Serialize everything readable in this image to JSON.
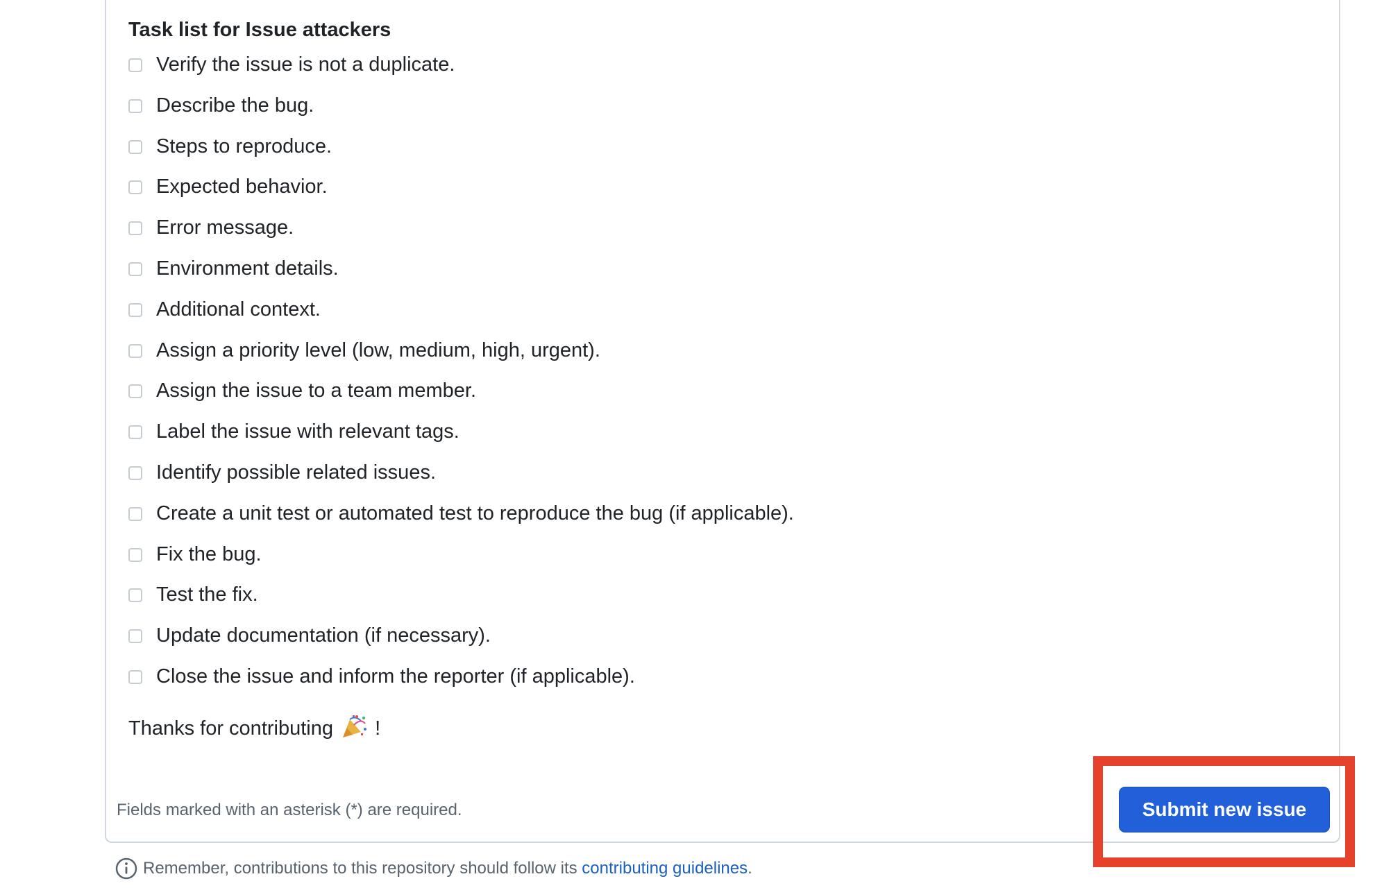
{
  "task_section": {
    "heading": "Task list for Issue attackers",
    "items": [
      {
        "label": "Verify the issue is not a duplicate.",
        "checked": false
      },
      {
        "label": "Describe the bug.",
        "checked": false
      },
      {
        "label": "Steps to reproduce.",
        "checked": false
      },
      {
        "label": "Expected behavior.",
        "checked": false
      },
      {
        "label": "Error message.",
        "checked": false
      },
      {
        "label": "Environment details.",
        "checked": false
      },
      {
        "label": "Additional context.",
        "checked": false
      },
      {
        "label": "Assign a priority level (low, medium, high, urgent).",
        "checked": false
      },
      {
        "label": "Assign the issue to a team member.",
        "checked": false
      },
      {
        "label": "Label the issue with relevant tags.",
        "checked": false
      },
      {
        "label": "Identify possible related issues.",
        "checked": false
      },
      {
        "label": "Create a unit test or automated test to reproduce the bug (if applicable).",
        "checked": false
      },
      {
        "label": "Fix the bug.",
        "checked": false
      },
      {
        "label": "Test the fix.",
        "checked": false
      },
      {
        "label": "Update documentation (if necessary).",
        "checked": false
      },
      {
        "label": "Close the issue and inform the reporter (if applicable).",
        "checked": false
      }
    ],
    "thanks_prefix": "Thanks for contributing",
    "thanks_icon": "party-popper-icon",
    "thanks_suffix": "!"
  },
  "form_footer": {
    "required_note": "Fields marked with an asterisk (*) are required.",
    "submit_label": "Submit new issue"
  },
  "page_footer": {
    "info_icon": "info-icon",
    "note_prefix": "Remember, contributions to this repository should follow its ",
    "link_text": "contributing guidelines",
    "note_suffix": "."
  },
  "colors": {
    "primary_button": "#2160d8",
    "link": "#1a5fc4",
    "highlight": "#e5412b"
  }
}
